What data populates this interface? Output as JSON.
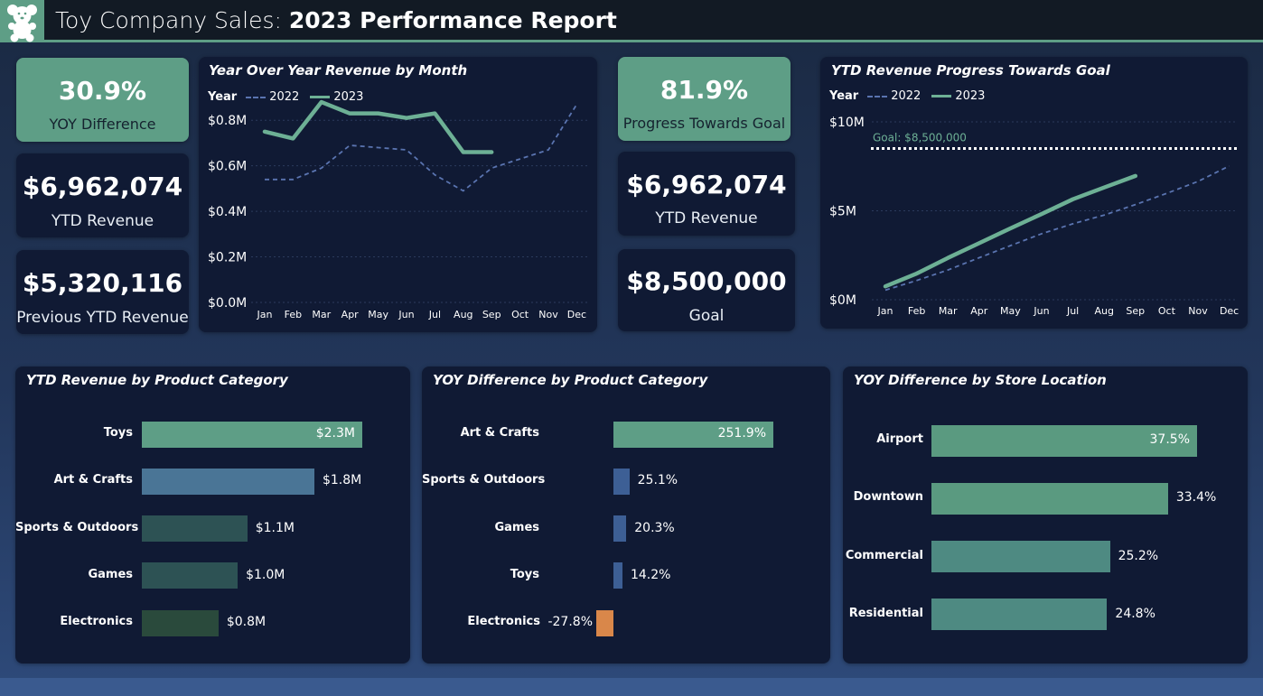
{
  "header": {
    "title_light": "Toy Company Sales: ",
    "title_bold": "2023 Performance Report",
    "logo_icon": "teddy-bear-icon"
  },
  "colors": {
    "accent_green": "#5e9e86",
    "dark_panel": "#101a34",
    "series_2022": "#5a74b0",
    "series_2023": "#6db095",
    "negative": "#d9874a"
  },
  "kpis": {
    "yoy_difference": {
      "value": "30.9%",
      "label": "YOY Difference"
    },
    "ytd_revenue_left": {
      "value": "$6,962,074",
      "label": "YTD Revenue"
    },
    "previous_ytd_revenue": {
      "value": "$5,320,116",
      "label": "Previous YTD Revenue"
    },
    "progress_towards_goal": {
      "value": "81.9%",
      "label": "Progress Towards Goal"
    },
    "ytd_revenue_right": {
      "value": "$6,962,074",
      "label": "YTD Revenue"
    },
    "goal": {
      "value": "$8,500,000",
      "label": "Goal"
    }
  },
  "yoy_chart": {
    "title": "Year Over Year Revenue by Month",
    "legend_title": "Year",
    "legend": [
      "2022",
      "2023"
    ]
  },
  "progress_chart": {
    "title": "YTD Revenue Progress Towards Goal",
    "legend_title": "Year",
    "legend": [
      "2022",
      "2023"
    ],
    "goal_label": "Goal: $8,500,000"
  },
  "category_revenue": {
    "title": "YTD Revenue by Product Category",
    "rows": [
      {
        "label": "Toys",
        "value": "$2.3M",
        "num": 2.3,
        "color": "#5e9e86",
        "inside": true
      },
      {
        "label": "Art & Crafts",
        "value": "$1.8M",
        "num": 1.8,
        "color": "#4a7596",
        "inside": false
      },
      {
        "label": "Sports & Outdoors",
        "value": "$1.1M",
        "num": 1.1,
        "color": "#2d5254",
        "inside": false
      },
      {
        "label": "Games",
        "value": "$1.0M",
        "num": 1.0,
        "color": "#2d5254",
        "inside": false
      },
      {
        "label": "Electronics",
        "value": "$0.8M",
        "num": 0.8,
        "color": "#2a4a3c",
        "inside": false
      }
    ]
  },
  "category_yoy": {
    "title": "YOY Difference by Product Category",
    "rows": [
      {
        "label": "Art & Crafts",
        "value": "251.9%",
        "num": 251.9,
        "color": "#5e9e86",
        "inside": true
      },
      {
        "label": "Sports & Outdoors",
        "value": "25.1%",
        "num": 25.1,
        "color": "#3d5f95",
        "inside": false
      },
      {
        "label": "Games",
        "value": "20.3%",
        "num": 20.3,
        "color": "#3d5f95",
        "inside": false
      },
      {
        "label": "Toys",
        "value": "14.2%",
        "num": 14.2,
        "color": "#3d5f95",
        "inside": false
      },
      {
        "label": "Electronics",
        "value": "-27.8%",
        "num": -27.8,
        "color": "#d9874a",
        "inside": false
      }
    ]
  },
  "store_yoy": {
    "title": "YOY Difference by Store Location",
    "rows": [
      {
        "label": "Airport",
        "value": "37.5%",
        "num": 37.5,
        "color": "#5a9a80",
        "inside": true
      },
      {
        "label": "Downtown",
        "value": "33.4%",
        "num": 33.4,
        "color": "#5a9a80",
        "inside": false
      },
      {
        "label": "Commercial",
        "value": "25.2%",
        "num": 25.2,
        "color": "#4e8a82",
        "inside": false
      },
      {
        "label": "Residential",
        "value": "24.8%",
        "num": 24.8,
        "color": "#4e8a82",
        "inside": false
      }
    ]
  },
  "chart_data": [
    {
      "type": "line",
      "title": "Year Over Year Revenue by Month",
      "x": [
        "Jan",
        "Feb",
        "Mar",
        "Apr",
        "May",
        "Jun",
        "Jul",
        "Aug",
        "Sep",
        "Oct",
        "Nov",
        "Dec"
      ],
      "y_ticks": [
        "$0.0M",
        "$0.2M",
        "$0.4M",
        "$0.6M",
        "$0.8M"
      ],
      "ylim": [
        0,
        0.9
      ],
      "grid": true,
      "legend_position": "top-left",
      "series": [
        {
          "name": "2022",
          "style": "dashed",
          "values": [
            0.54,
            0.54,
            0.59,
            0.69,
            0.68,
            0.67,
            0.56,
            0.49,
            0.59,
            0.63,
            0.67,
            0.87
          ]
        },
        {
          "name": "2023",
          "style": "solid",
          "values": [
            0.75,
            0.72,
            0.88,
            0.83,
            0.83,
            0.81,
            0.83,
            0.66,
            0.66
          ]
        }
      ]
    },
    {
      "type": "line",
      "title": "YTD Revenue Progress Towards Goal",
      "x": [
        "Jan",
        "Feb",
        "Mar",
        "Apr",
        "May",
        "Jun",
        "Jul",
        "Aug",
        "Sep",
        "Oct",
        "Nov",
        "Dec"
      ],
      "y_ticks": [
        "$0M",
        "$5M",
        "$10M"
      ],
      "ylim": [
        0,
        10
      ],
      "grid": true,
      "goal": 8.5,
      "legend_position": "top-left",
      "series": [
        {
          "name": "2022",
          "style": "dashed",
          "values": [
            0.54,
            1.08,
            1.67,
            2.36,
            3.04,
            3.71,
            4.27,
            4.76,
            5.35,
            5.98,
            6.65,
            7.52
          ]
        },
        {
          "name": "2023",
          "style": "solid",
          "values": [
            0.75,
            1.47,
            2.35,
            3.18,
            4.01,
            4.82,
            5.65,
            6.31,
            6.96
          ]
        }
      ]
    },
    {
      "type": "bar",
      "title": "YTD Revenue by Product Category",
      "categories": [
        "Toys",
        "Art & Crafts",
        "Sports & Outdoors",
        "Games",
        "Electronics"
      ],
      "values": [
        2.3,
        1.8,
        1.1,
        1.0,
        0.8
      ]
    },
    {
      "type": "bar",
      "title": "YOY Difference by Product Category",
      "categories": [
        "Art & Crafts",
        "Sports & Outdoors",
        "Games",
        "Toys",
        "Electronics"
      ],
      "values": [
        251.9,
        25.1,
        20.3,
        14.2,
        -27.8
      ]
    },
    {
      "type": "bar",
      "title": "YOY Difference by Store Location",
      "categories": [
        "Airport",
        "Downtown",
        "Commercial",
        "Residential"
      ],
      "values": [
        37.5,
        33.4,
        25.2,
        24.8
      ]
    }
  ]
}
